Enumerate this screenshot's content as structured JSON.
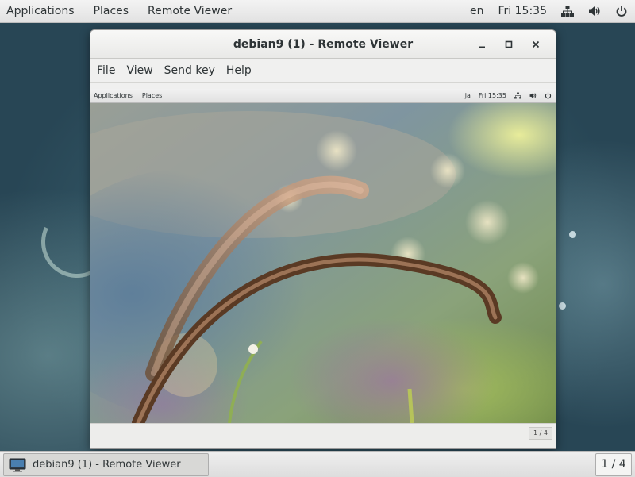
{
  "topbar": {
    "applications": "Applications",
    "places": "Places",
    "app_name": "Remote Viewer",
    "keyboard_layout": "en",
    "clock": "Fri 15:35"
  },
  "window": {
    "title": "debian9 (1) - Remote Viewer",
    "controls": {
      "minimize": "_",
      "maximize": "□",
      "close": "×"
    },
    "menu": [
      "File",
      "View",
      "Send key",
      "Help"
    ]
  },
  "guest": {
    "topbar": {
      "applications": "Applications",
      "places": "Places",
      "keyboard_layout": "ja",
      "clock": "Fri 15:35"
    },
    "workspace_indicator": "1 / 4"
  },
  "taskbar": {
    "window_item": "debian9  (1) - Remote Viewer",
    "workspace_indicator": "1 / 4"
  },
  "icons": {
    "network": "network-icon",
    "volume": "volume-icon",
    "power": "power-icon",
    "taskbar_app": "monitor-icon"
  }
}
